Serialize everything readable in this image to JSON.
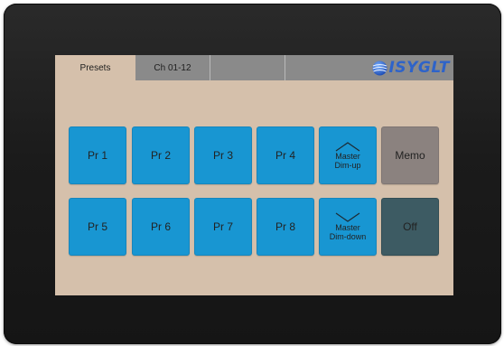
{
  "tabs": [
    {
      "label": "Presets",
      "active": true
    },
    {
      "label": "Ch 01-12",
      "active": false
    },
    {
      "label": "",
      "active": false
    },
    {
      "label": "",
      "active": false
    }
  ],
  "brand": {
    "text": "ISYGLT",
    "color": "#2e63c9"
  },
  "presets": [
    "Pr 1",
    "Pr 2",
    "Pr 3",
    "Pr 4",
    "Pr 5",
    "Pr 6",
    "Pr 7",
    "Pr 8"
  ],
  "master_up": {
    "line1": "Master",
    "line2": "Dim-up",
    "icon": "chevron-up-icon"
  },
  "master_down": {
    "line1": "Master",
    "line2": "Dim-down",
    "icon": "chevron-down-icon"
  },
  "memo_label": "Memo",
  "off_label": "Off",
  "colors": {
    "screen_bg": "#d5c0ab",
    "preset_button": "#1896d2",
    "memo_button": "#8b827f",
    "off_button": "#3d5b63",
    "tabbar": "#8a8a8a"
  }
}
